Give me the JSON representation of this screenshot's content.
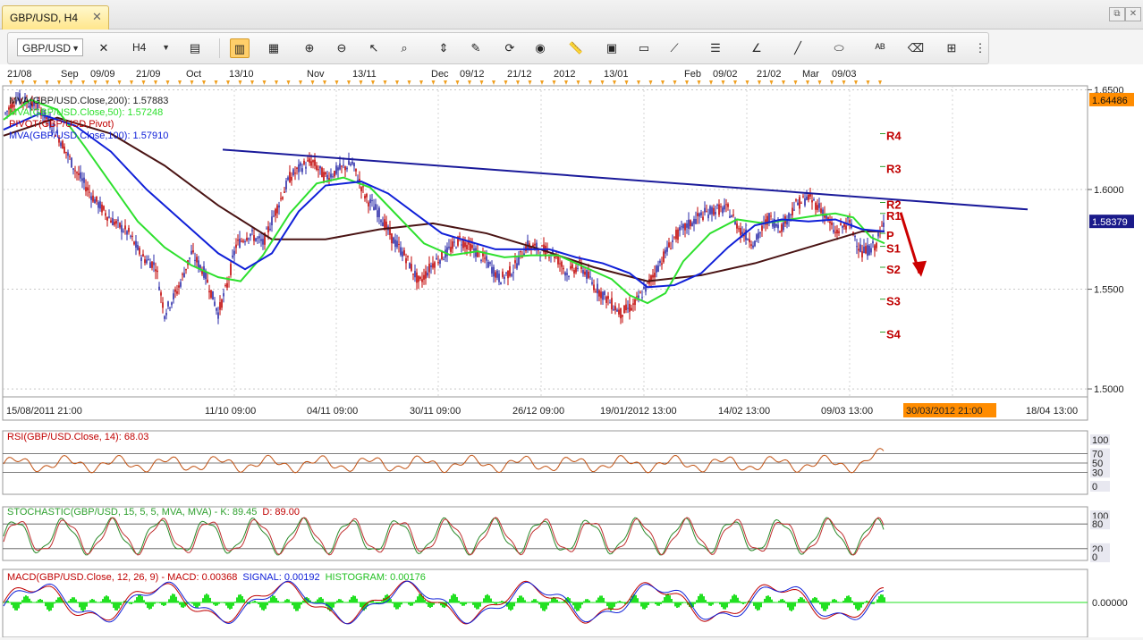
{
  "tab": {
    "title": "GBP/USD, H4",
    "close": "✕"
  },
  "window_controls": {
    "restore": "⧉",
    "close": "✕"
  },
  "toolbar": {
    "symbol": "GBP/USD",
    "timeframe": "H4",
    "icons": [
      "chart-type-icon",
      "crosshair-icon",
      "indicators-icon",
      "bar-chart-icon",
      "candle-chart-icon",
      "zoom-in-icon",
      "zoom-out-icon",
      "cursor-icon",
      "zoom-area-icon",
      "fit-icon",
      "edit-icon",
      "refresh-icon",
      "globe-icon",
      "ruler-icon",
      "image-icon",
      "template-icon",
      "drawing-tools-icon",
      "list-icon",
      "trend-line-icon",
      "line-icon",
      "ellipse-icon",
      "text-icon",
      "eraser-icon",
      "hierarchy-icon",
      "menu-icon"
    ]
  },
  "colors": {
    "up": "#2a2aa8",
    "down": "#c00000",
    "ma50": "#2ee02e",
    "ma100": "#1020d8",
    "ma200": "#4a1414",
    "pivot": "#c00000",
    "trend": "#1a1a9a",
    "price_tag": "#ff8c00"
  },
  "top_time_labels": [
    "21/08",
    "Sep",
    "09/09",
    "21/09",
    "Oct",
    "13/10",
    "Nov",
    "13/11",
    "Dec",
    "09/12",
    "21/12",
    "2012",
    "13/01",
    "Feb",
    "09/02",
    "21/02",
    "Mar",
    "09/03"
  ],
  "chart_data": [
    {
      "type": "candlestick",
      "title": "GBP/USD, H4",
      "ylim": [
        1.496,
        1.652
      ],
      "y_ticks": [
        "1.6500",
        "1.6000",
        "1.5500",
        "1.5000"
      ],
      "x_ticks": [
        "15/08/2011 21:00",
        "11/10 09:00",
        "04/11 09:00",
        "30/11 09:00",
        "26/12 09:00",
        "19/01/2012 13:00",
        "14/02 13:00",
        "09/03 13:00",
        "30/03/2012 21:00",
        "18/04 13:00"
      ],
      "price_tags": {
        "top": "1.64486",
        "current": "1.58379"
      },
      "price_series": [
        [
          0,
          1.637
        ],
        [
          15,
          1.646
        ],
        [
          40,
          1.641
        ],
        [
          60,
          1.628
        ],
        [
          80,
          1.61
        ],
        [
          100,
          1.596
        ],
        [
          120,
          1.585
        ],
        [
          140,
          1.578
        ],
        [
          155,
          1.566
        ],
        [
          170,
          1.562
        ],
        [
          180,
          1.538
        ],
        [
          195,
          1.55
        ],
        [
          210,
          1.568
        ],
        [
          225,
          1.558
        ],
        [
          240,
          1.538
        ],
        [
          250,
          1.552
        ],
        [
          260,
          1.572
        ],
        [
          275,
          1.578
        ],
        [
          290,
          1.573
        ],
        [
          305,
          1.59
        ],
        [
          320,
          1.606
        ],
        [
          335,
          1.612
        ],
        [
          345,
          1.614
        ],
        [
          360,
          1.606
        ],
        [
          375,
          1.61
        ],
        [
          390,
          1.613
        ],
        [
          405,
          1.596
        ],
        [
          420,
          1.588
        ],
        [
          435,
          1.575
        ],
        [
          450,
          1.566
        ],
        [
          465,
          1.553
        ],
        [
          480,
          1.563
        ],
        [
          495,
          1.568
        ],
        [
          510,
          1.575
        ],
        [
          525,
          1.57
        ],
        [
          540,
          1.564
        ],
        [
          555,
          1.555
        ],
        [
          570,
          1.56
        ],
        [
          585,
          1.572
        ],
        [
          600,
          1.57
        ],
        [
          615,
          1.568
        ],
        [
          630,
          1.558
        ],
        [
          645,
          1.562
        ],
        [
          660,
          1.552
        ],
        [
          675,
          1.545
        ],
        [
          690,
          1.538
        ],
        [
          705,
          1.542
        ],
        [
          720,
          1.552
        ],
        [
          735,
          1.564
        ],
        [
          750,
          1.576
        ],
        [
          765,
          1.582
        ],
        [
          780,
          1.587
        ],
        [
          795,
          1.59
        ],
        [
          810,
          1.59
        ],
        [
          825,
          1.579
        ],
        [
          840,
          1.573
        ],
        [
          855,
          1.586
        ],
        [
          870,
          1.581
        ],
        [
          885,
          1.592
        ],
        [
          900,
          1.596
        ],
        [
          915,
          1.59
        ],
        [
          930,
          1.578
        ],
        [
          945,
          1.584
        ],
        [
          960,
          1.568
        ],
        [
          975,
          1.572
        ],
        [
          985,
          1.584
        ]
      ],
      "series": [
        {
          "name": "MVA(GBP/USD.Close,200)",
          "value": "1.57883",
          "color": "#4a1414",
          "points": [
            [
              0,
              1.627
            ],
            [
              60,
              1.636
            ],
            [
              120,
              1.628
            ],
            [
              180,
              1.612
            ],
            [
              240,
              1.592
            ],
            [
              300,
              1.575
            ],
            [
              360,
              1.575
            ],
            [
              420,
              1.58
            ],
            [
              480,
              1.583
            ],
            [
              540,
              1.578
            ],
            [
              600,
              1.57
            ],
            [
              660,
              1.561
            ],
            [
              720,
              1.554
            ],
            [
              780,
              1.557
            ],
            [
              840,
              1.563
            ],
            [
              900,
              1.571
            ],
            [
              960,
              1.579
            ],
            [
              985,
              1.579
            ]
          ]
        },
        {
          "name": "MVA(GBP/USD.Close,50)",
          "value": "1.57248",
          "color": "#2ee02e",
          "points": [
            [
              0,
              1.635
            ],
            [
              30,
              1.645
            ],
            [
              60,
              1.64
            ],
            [
              90,
              1.622
            ],
            [
              120,
              1.603
            ],
            [
              150,
              1.584
            ],
            [
              180,
              1.571
            ],
            [
              210,
              1.562
            ],
            [
              240,
              1.556
            ],
            [
              265,
              1.554
            ],
            [
              290,
              1.567
            ],
            [
              320,
              1.588
            ],
            [
              350,
              1.603
            ],
            [
              380,
              1.606
            ],
            [
              410,
              1.601
            ],
            [
              440,
              1.587
            ],
            [
              470,
              1.573
            ],
            [
              500,
              1.567
            ],
            [
              530,
              1.569
            ],
            [
              560,
              1.566
            ],
            [
              590,
              1.567
            ],
            [
              620,
              1.567
            ],
            [
              650,
              1.561
            ],
            [
              680,
              1.555
            ],
            [
              700,
              1.547
            ],
            [
              720,
              1.543
            ],
            [
              740,
              1.548
            ],
            [
              760,
              1.564
            ],
            [
              790,
              1.578
            ],
            [
              820,
              1.585
            ],
            [
              850,
              1.583
            ],
            [
              880,
              1.585
            ],
            [
              910,
              1.587
            ],
            [
              930,
              1.588
            ],
            [
              950,
              1.586
            ],
            [
              970,
              1.576
            ],
            [
              985,
              1.573
            ]
          ]
        },
        {
          "name": "PIVOT(GBP/USD,Pivot)",
          "value": "",
          "color": "#c00000",
          "points": []
        },
        {
          "name": "MVA(GBP/USD.Close,100)",
          "value": "1.57910",
          "color": "#1020d8",
          "points": [
            [
              0,
              1.63
            ],
            [
              40,
              1.638
            ],
            [
              80,
              1.632
            ],
            [
              120,
              1.619
            ],
            [
              160,
              1.6
            ],
            [
              200,
              1.584
            ],
            [
              240,
              1.568
            ],
            [
              270,
              1.56
            ],
            [
              300,
              1.568
            ],
            [
              330,
              1.589
            ],
            [
              360,
              1.602
            ],
            [
              400,
              1.604
            ],
            [
              430,
              1.598
            ],
            [
              460,
              1.588
            ],
            [
              490,
              1.578
            ],
            [
              520,
              1.574
            ],
            [
              550,
              1.57
            ],
            [
              580,
              1.57
            ],
            [
              610,
              1.57
            ],
            [
              640,
              1.566
            ],
            [
              670,
              1.563
            ],
            [
              700,
              1.558
            ],
            [
              720,
              1.551
            ],
            [
              750,
              1.552
            ],
            [
              780,
              1.558
            ],
            [
              810,
              1.571
            ],
            [
              840,
              1.582
            ],
            [
              870,
              1.585
            ],
            [
              900,
              1.584
            ],
            [
              930,
              1.585
            ],
            [
              960,
              1.58
            ],
            [
              985,
              1.579
            ]
          ]
        }
      ],
      "trend_line": [
        [
          245,
          1.62
        ],
        [
          1145,
          1.59
        ]
      ],
      "pivot_levels": [
        {
          "label": "R4",
          "value": 1.628
        },
        {
          "label": "R3",
          "value": 1.6115
        },
        {
          "label": "R2",
          "value": 1.5935
        },
        {
          "label": "R1",
          "value": 1.588
        },
        {
          "label": "P",
          "value": 1.578
        },
        {
          "label": "S1",
          "value": 1.5715
        },
        {
          "label": "S2",
          "value": 1.561
        },
        {
          "label": "S3",
          "value": 1.545
        },
        {
          "label": "S4",
          "value": 1.5285
        }
      ],
      "arrow": [
        [
          1003,
          1.5885
        ],
        [
          1024,
          1.558
        ]
      ]
    },
    {
      "type": "line",
      "title": "RSI(GBP/USD.Close, 14): 68.03",
      "ylim": [
        0,
        100
      ],
      "y_ticks": [
        "100",
        "70",
        "50",
        "30",
        "0"
      ],
      "level_lines": [
        70,
        50,
        30
      ],
      "series": [
        {
          "name": "RSI(GBP/USD.Close, 14)",
          "value": "68.03",
          "color": "#c05010"
        }
      ]
    },
    {
      "type": "line",
      "title": "STOCHASTIC(GBP/USD, 15, 5, 5, MVA, MVA) - K: 89.45 D: 89.00",
      "ylim": [
        0,
        100
      ],
      "y_ticks": [
        "100",
        "80",
        "20",
        "0"
      ],
      "level_lines": [
        80,
        20
      ],
      "series": [
        {
          "name": "K",
          "value": "89.45",
          "color": "#2a8a2a"
        },
        {
          "name": "D",
          "value": "89.00",
          "color": "#c03030"
        }
      ]
    },
    {
      "type": "line",
      "title": "MACD(GBP/USD.Close, 12, 26, 9) - MACD: 0.00368 SIGNAL: 0.00192 HISTOGRAM: 0.00176",
      "y_ticks": [
        "0.00000"
      ],
      "series": [
        {
          "name": "MACD",
          "value": "0.00368",
          "color": "#c00000"
        },
        {
          "name": "SIGNAL",
          "value": "0.00192",
          "color": "#1020d8"
        },
        {
          "name": "HISTOGRAM",
          "value": "0.00176",
          "color": "#22e022"
        }
      ]
    }
  ],
  "panels": {
    "rsi": {
      "prefix": "RSI(GBP/USD.Close, 14): ",
      "value": "68.03"
    },
    "stoch": {
      "prefix": "STOCHASTIC(GBP/USD, 15, 5, 5, MVA, MVA) - ",
      "k_label": "K: 89.45",
      "d_label": "D: 89.00"
    },
    "macd": {
      "prefix": "MACD(GBP/USD.Close, 12, 26, 9) - ",
      "macd_label": "MACD: 0.00368",
      "signal_label": "SIGNAL: 0.00192",
      "hist_label": "HISTOGRAM: 0.00176"
    }
  }
}
